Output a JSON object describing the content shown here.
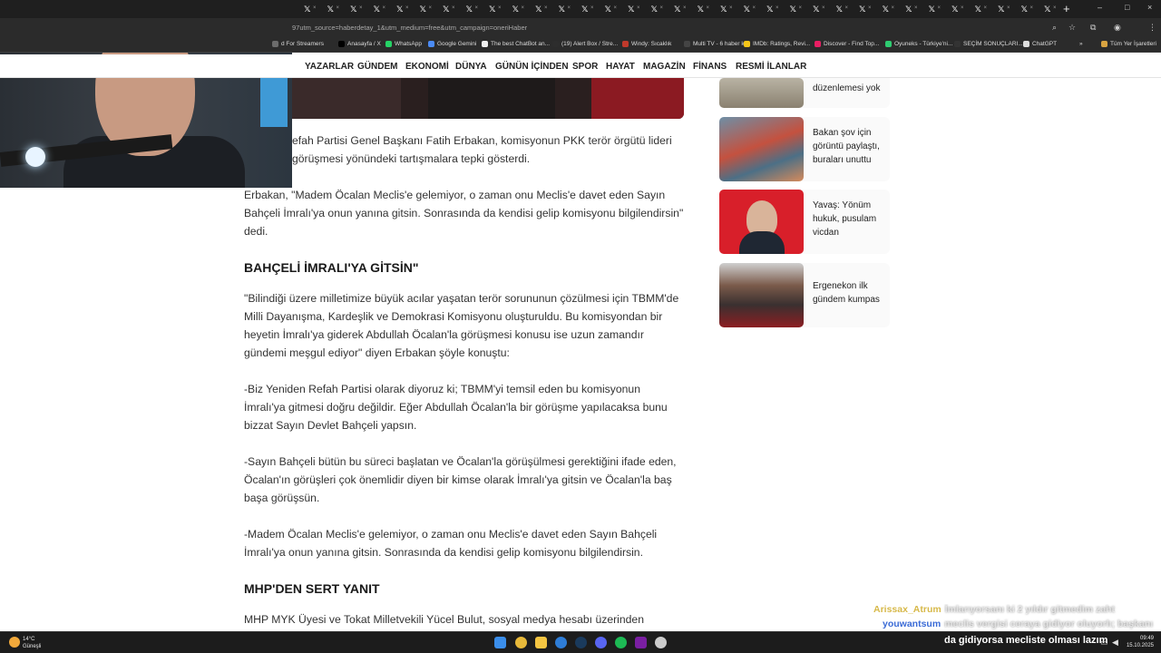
{
  "browser": {
    "tab_glyph": "𝕏",
    "tab_close": "×",
    "tab_count": 33,
    "new_tab": "+",
    "url": "97utm_source=haberdetay_1&utm_medium=free&utm_campaign=oneriHaber",
    "window_controls": [
      "–",
      "□",
      "×"
    ],
    "address_icons": [
      "zoom-icon",
      "star-icon",
      "extensions-icon",
      "profile-icon",
      "menu-icon"
    ]
  },
  "bookmarks": [
    {
      "label": "d For Streamers",
      "color": "#6c6c6c"
    },
    {
      "label": "Anasayfa / X",
      "color": "#000000"
    },
    {
      "label": "WhatsApp",
      "color": "#25d366"
    },
    {
      "label": "Google Gemini",
      "color": "#4b8bf5"
    },
    {
      "label": "The best ChatBot an...",
      "color": "#f0f0f0"
    },
    {
      "label": "(19) Alert Box / Stre...",
      "color": "#2d2d2d"
    },
    {
      "label": "Windy: Sıcaklık",
      "color": "#c0392b"
    },
    {
      "label": "Multi TV - 6 haber k...",
      "color": "#444444"
    },
    {
      "label": "IMDb: Ratings, Revi...",
      "color": "#f5c518"
    },
    {
      "label": "Discover - Find Top...",
      "color": "#e91e63"
    },
    {
      "label": "Oyuneks - Türkiye'ni...",
      "color": "#2ecc71"
    },
    {
      "label": "SEÇİM SONUÇLARI...",
      "color": "#333333"
    },
    {
      "label": "ChatGPT",
      "color": "#dddddd"
    }
  ],
  "bookmarks_more": "»",
  "bookmarks_all": "Tüm Yer İşaretleri",
  "site_nav": [
    "YAZARLAR",
    "GÜNDEM",
    "EKONOMİ",
    "DÜNYA",
    "GÜNÜN İÇİNDEN",
    "SPOR",
    "HAYAT",
    "MAGAZİN",
    "FİNANS",
    "RESMİ İLANLAR"
  ],
  "article": {
    "p1": "efah Partisi Genel Başkanı Fatih Erbakan, komisyonun PKK terör örgütü lideri görüşmesi yönündeki tartışmalara tepki gösterdi.",
    "p2": "Erbakan, \"Madem Öcalan Meclis'e gelemiyor, o zaman onu Meclis'e davet eden Sayın Bahçeli İmralı'ya onun yanına gitsin. Sonrasında da kendisi gelip komisyonu bilgilendirsin\" dedi.",
    "h1": "BAHÇELİ İMRALI'YA GİTSİN\"",
    "p3": "\"Bilindiği üzere milletimize büyük acılar yaşatan terör sorununun çözülmesi için TBMM'de Milli Dayanışma, Kardeşlik ve Demokrasi Komisyonu oluşturuldu. Bu komisyondan bir heyetin İmralı'ya giderek Abdullah Öcalan'la görüşmesi konusu ise uzun zamandır gündemi meşgul ediyor\" diyen Erbakan şöyle konuştu:",
    "p4": "-Biz Yeniden Refah Partisi olarak diyoruz ki; TBMM'yi temsil eden bu komisyonun İmralı'ya gitmesi doğru değildir. Eğer Abdullah Öcalan'la bir görüşme yapılacaksa bunu bizzat Sayın Devlet Bahçeli yapsın.",
    "p5": "-Sayın Bahçeli bütün bu süreci başlatan ve Öcalan'la görüşülmesi gerektiğini ifade eden, Öcalan'ın görüşleri çok önemlidir diyen bir kimse olarak İmralı'ya gitsin ve Öcalan'la baş başa görüşsün.",
    "p6": "-Madem Öcalan Meclis'e gelemiyor, o zaman onu Meclis'e davet eden Sayın Bahçeli İmralı'ya onun yanına gitsin. Sonrasında da kendisi gelip komisyonu bilgilendirsin.",
    "h2": "MHP'DEN SERT YANIT",
    "p7": "MHP MYK Üyesi ve Tokat Milletvekili Yücel Bulut, sosyal medya hesabı üzerinden"
  },
  "sidebar": [
    {
      "title": "düzenlemesi yok"
    },
    {
      "title": "Bakan şov için görüntü paylaştı, buraları unuttu"
    },
    {
      "title": "Yavaş: Yönüm hukuk, pusulam vicdan"
    },
    {
      "title": "Ergenekon ilk gündem kumpas"
    }
  ],
  "chat": [
    {
      "user": "Arissax_Atrum",
      "color": "#d7b94a",
      "msg": "İmlarıyorsanı ki 2 yıldır gitmedim zaht"
    },
    {
      "user": "youwantsum",
      "color": "#3b6bd6",
      "msg": "meclis vergisi ceraya gidiyor oluyorlı; başkanı"
    }
  ],
  "taskbar": {
    "weather_temp": "14°C",
    "weather_desc": "Güneşli",
    "tray_text": "da gidiyorsa mecliste olması lazım",
    "time": "09:49",
    "date": "15.10.2025",
    "apps": [
      "windows-start-icon",
      "chrome-icon",
      "file-explorer-icon",
      "edge-icon",
      "steam-icon",
      "discord-icon",
      "spotify-icon",
      "obs-icon",
      "game-app-icon"
    ],
    "app_colors": [
      "#3b8eea",
      "#e8b93a",
      "#f4c542",
      "#2e7dd7",
      "#1a3a5c",
      "#5865f2",
      "#1db954",
      "#7a1fa2",
      "#cccccc"
    ]
  }
}
